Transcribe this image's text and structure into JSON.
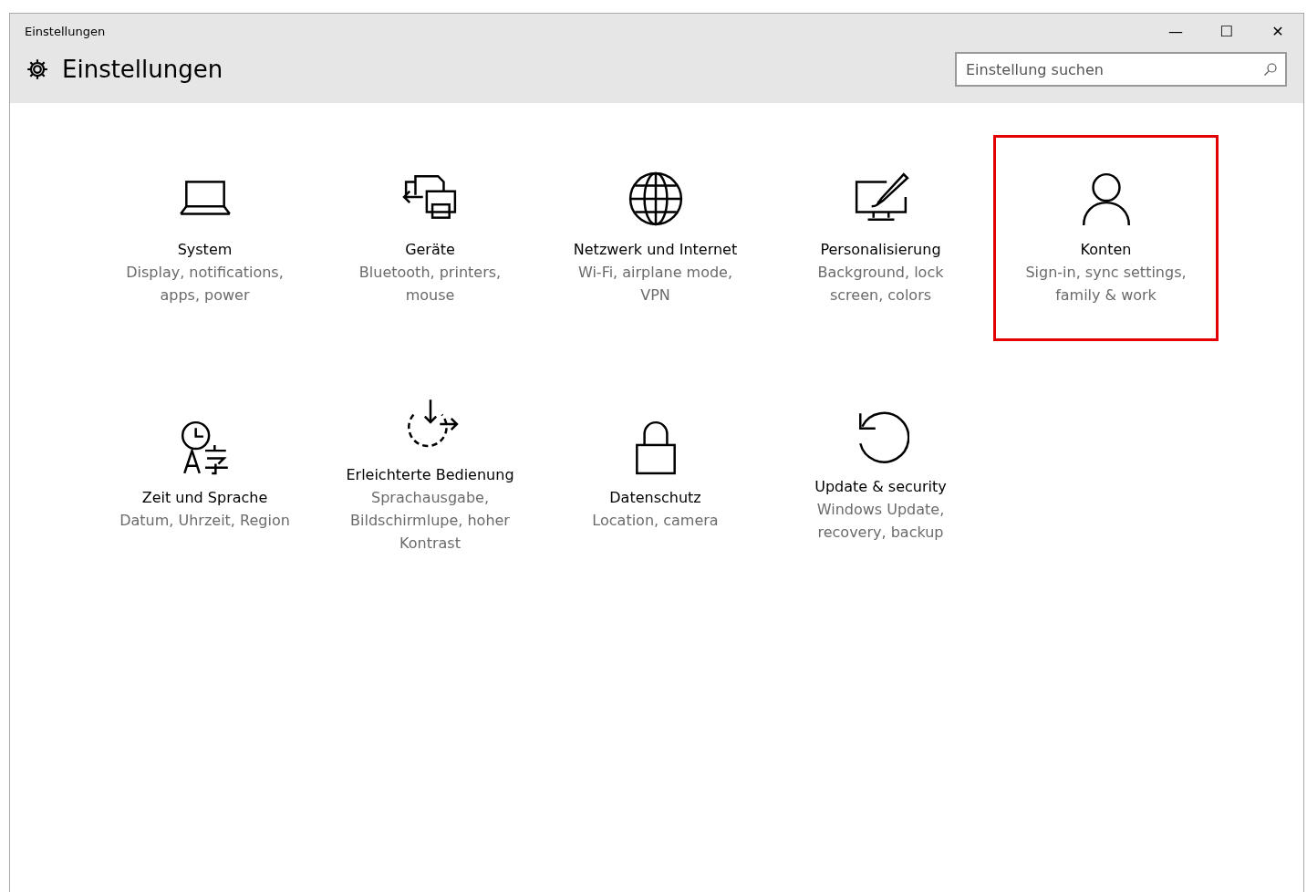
{
  "window": {
    "title": "Einstellungen",
    "controls": [
      "—",
      "☐",
      "✕"
    ]
  },
  "header": {
    "title": "Einstellungen"
  },
  "search": {
    "placeholder": "Einstellung suchen"
  },
  "categories": [
    {
      "kind": "laptop",
      "label": "System",
      "description": "Display, notifications, apps, power",
      "highlighted": false
    },
    {
      "kind": "devices",
      "label": "Geräte",
      "description": "Bluetooth, printers, mouse",
      "highlighted": false
    },
    {
      "kind": "globe",
      "label": "Netzwerk und Internet",
      "description": "Wi-Fi, airplane mode, VPN",
      "highlighted": false
    },
    {
      "kind": "paint",
      "label": "Personalisierung",
      "description": "Background, lock screen, colors",
      "highlighted": false
    },
    {
      "kind": "person",
      "label": "Konten",
      "description": "Sign-in, sync settings, family & work",
      "highlighted": true
    },
    {
      "kind": "time",
      "label": "Zeit und Sprache",
      "description": "Datum, Uhrzeit, Region",
      "highlighted": false
    },
    {
      "kind": "access",
      "label": "Erleichterte Bedienung",
      "description": "Sprachausgabe, Bildschirmlupe, hoher Kontrast",
      "highlighted": false
    },
    {
      "kind": "lock",
      "label": "Datenschutz",
      "description": "Location, camera",
      "highlighted": false
    },
    {
      "kind": "update",
      "label": "Update & security",
      "description": "Windows Update, recovery, backup",
      "highlighted": false
    }
  ]
}
